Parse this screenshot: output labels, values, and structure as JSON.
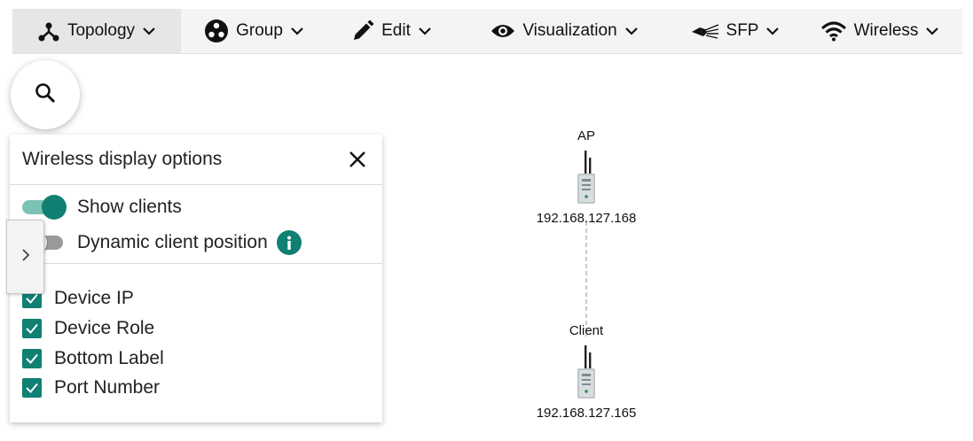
{
  "toolbar": {
    "items": [
      {
        "label": "Topology",
        "icon": "topology-icon",
        "active": true
      },
      {
        "label": "Group",
        "icon": "group-icon"
      },
      {
        "label": "Edit",
        "icon": "pencil-icon"
      },
      {
        "label": "Visualization",
        "icon": "eye-icon"
      },
      {
        "label": "SFP",
        "icon": "sfp-icon"
      },
      {
        "label": "Wireless",
        "icon": "wifi-icon"
      }
    ]
  },
  "search": {
    "icon": "search-icon"
  },
  "panel": {
    "title": "Wireless display options",
    "toggles": [
      {
        "label": "Show clients",
        "on": true
      },
      {
        "label": "Dynamic client position",
        "on": false
      }
    ],
    "checkboxes": [
      {
        "label": "Device IP",
        "checked": true
      },
      {
        "label": "Device Role",
        "checked": true
      },
      {
        "label": "Bottom Label",
        "checked": true
      },
      {
        "label": "Port Number",
        "checked": true
      }
    ]
  },
  "topology": {
    "nodes": [
      {
        "role": "AP",
        "ip": "192.168.127.168"
      },
      {
        "role": "Client",
        "ip": "192.168.127.165"
      }
    ]
  },
  "colors": {
    "accent": "#0f8072",
    "toolbar_bg": "#f4f4f4"
  }
}
